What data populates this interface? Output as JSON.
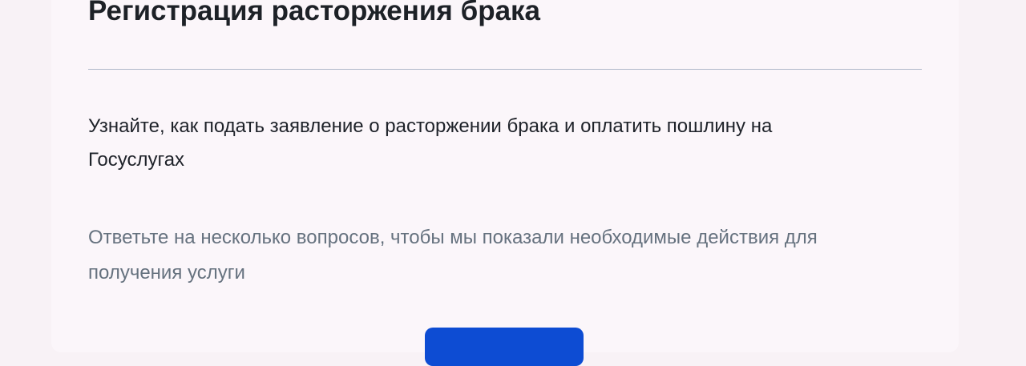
{
  "page": {
    "title": "Регистрация расторжения брака",
    "lead": "Узнайте, как подать заявление о расторжении брака и оплатить пошлину на Госуслугах",
    "hint": "Ответьте на несколько вопросов, чтобы мы показали необходимые действия для получения услуги"
  },
  "colors": {
    "background": "#f8f2f6",
    "primary_button": "#0d4cd3",
    "text_primary": "#1e2229",
    "text_secondary": "#66727f"
  }
}
